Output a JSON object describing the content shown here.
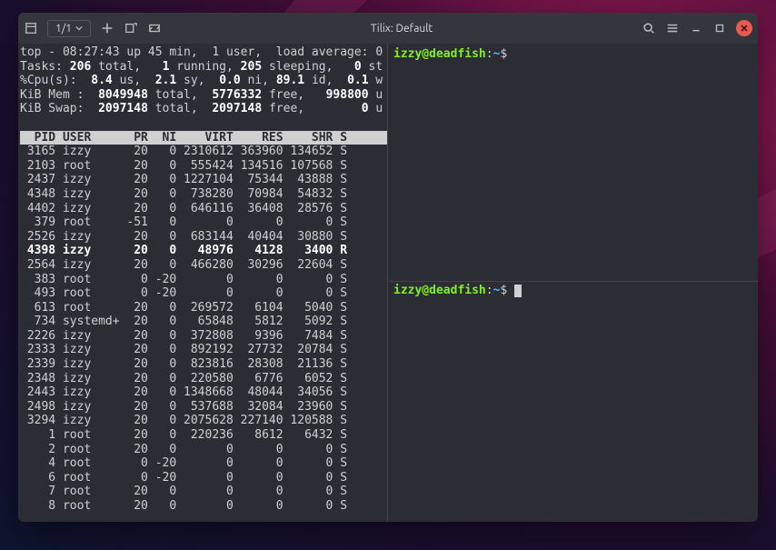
{
  "titlebar": {
    "tab_label": "1/1",
    "title": "Tilix: Default"
  },
  "top": {
    "line1_a": "top - 08:27:43 up 45 min,  1 user,  load average: 0",
    "tasks_a": "Tasks: ",
    "tasks_total": "206",
    "tasks_b": " total,   ",
    "tasks_run": "1",
    "tasks_c": " running, ",
    "tasks_sleep": "205",
    "tasks_d": " sleeping,   ",
    "tasks_stopped": "0",
    "tasks_e": " st",
    "cpu_a": "%Cpu(s):  ",
    "cpu_us": "8.4",
    "cpu_b": " us,  ",
    "cpu_sy": "2.1",
    "cpu_c": " sy,  ",
    "cpu_ni": "0.0",
    "cpu_d": " ni, ",
    "cpu_id": "89.1",
    "cpu_e": " id,  ",
    "cpu_wa": "0.1",
    "cpu_f": " w",
    "mem_a": "KiB Mem : ",
    "mem_total": " 8049948",
    "mem_b": " total,  ",
    "mem_free": "5776332",
    "mem_c": " free,   ",
    "mem_used": "998800",
    "mem_d": " u",
    "swap_a": "KiB Swap: ",
    "swap_total": " 2097148",
    "swap_b": " total,  ",
    "swap_free": "2097148",
    "swap_c": " free,        ",
    "swap_used": "0",
    "swap_d": " u",
    "header": "  PID USER      PR  NI    VIRT    RES    SHR S",
    "rows": [
      " 3165 izzy      20   0 2310612 363960 134652 S",
      " 2103 root      20   0  555424 134516 107568 S",
      " 2437 izzy      20   0 1227104  75344  43888 S",
      " 4348 izzy      20   0  738280  70984  54832 S",
      " 4402 izzy      20   0  646116  36408  28576 S",
      "  379 root     -51   0       0      0      0 S",
      " 2526 izzy      20   0  683144  40404  30880 S",
      " 4398 izzy      20   0   48976   4128   3400 R",
      " 2564 izzy      20   0  466280  30296  22604 S",
      "  383 root       0 -20       0      0      0 S",
      "  493 root       0 -20       0      0      0 S",
      "  613 root      20   0  269572   6104   5040 S",
      "  734 systemd+  20   0   65848   5812   5092 S",
      " 2226 izzy      20   0  372808   9396   7484 S",
      " 2333 izzy      20   0  892192  27732  20784 S",
      " 2339 izzy      20   0  823816  28308  21136 S",
      " 2348 izzy      20   0  220580   6776   6052 S",
      " 2443 izzy      20   0 1348668  48044  34056 S",
      " 2498 izzy      20   0  537688  32084  23960 S",
      " 3294 izzy      20   0 2075628 227140 120588 S",
      "    1 root      20   0  220236   8612   6432 S",
      "    2 root      20   0       0      0      0 S",
      "    4 root       0 -20       0      0      0 S",
      "    6 root       0 -20       0      0      0 S",
      "    7 root      20   0       0      0      0 S",
      "    8 root      20   0       0      0      0 S"
    ],
    "bold_row_index": 7
  },
  "prompt": {
    "user_host": "izzy@deadfish",
    "sep": ":",
    "path": "~",
    "dollar": "$ "
  }
}
